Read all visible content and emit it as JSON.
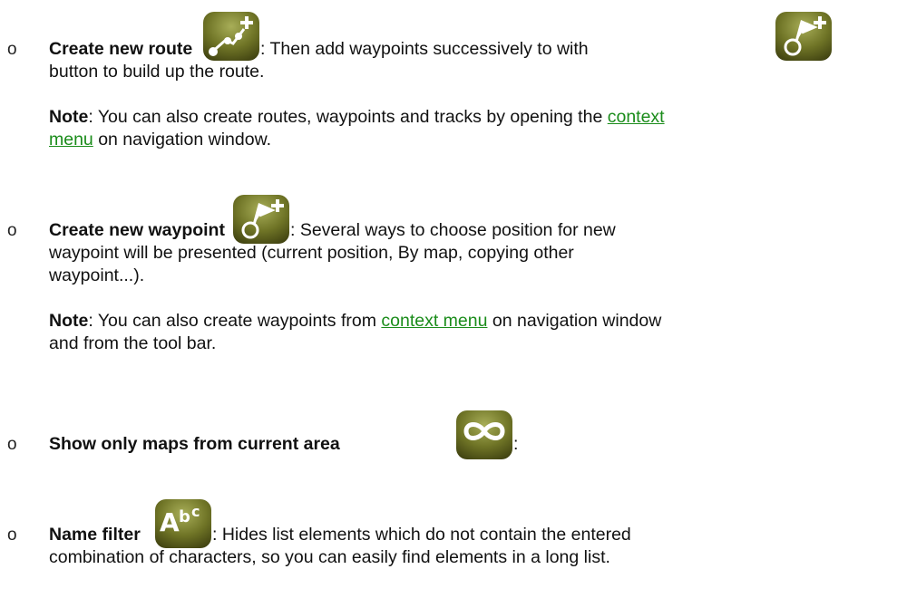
{
  "bullet_symbol": "o",
  "item_route": {
    "title": "Create new route",
    "desc_a": ": Then add waypoints successively to with",
    "desc_b": "button to build up the route.",
    "icon": "route-add-icon",
    "button_icon": "waypoint-add-icon"
  },
  "note_1": {
    "label": "Note",
    "text_a": ": You can also create routes, waypoints and tracks by opening the ",
    "link_a": "context",
    "link_b": "menu",
    "text_b": " on navigation window."
  },
  "item_waypoint": {
    "title": "Create new waypoint",
    "desc_a": ": Several ways to choose position for new",
    "desc_b": "waypoint will be presented (current position, By map, copying other",
    "desc_c": "waypoint...).",
    "icon": "waypoint-add-icon"
  },
  "note_2": {
    "label": "Note",
    "text_a": ": You can also create waypoints from ",
    "link": "context menu",
    "text_b": " on navigation window",
    "text_c": "and from the tool bar."
  },
  "item_area": {
    "title": "Show only maps from current area",
    "desc": ":",
    "icon": "infinity-icon"
  },
  "item_filter": {
    "title": "Name filter",
    "desc_a": ": Hides list elements which do not contain the entered",
    "desc_b": "combination of characters, so you can easily find elements in a long list.",
    "icon": "abc-filter-icon"
  },
  "colors": {
    "icon_bg_light": "#a8ae58",
    "icon_bg_dark": "#3e4010",
    "link": "#1a8c1a"
  }
}
